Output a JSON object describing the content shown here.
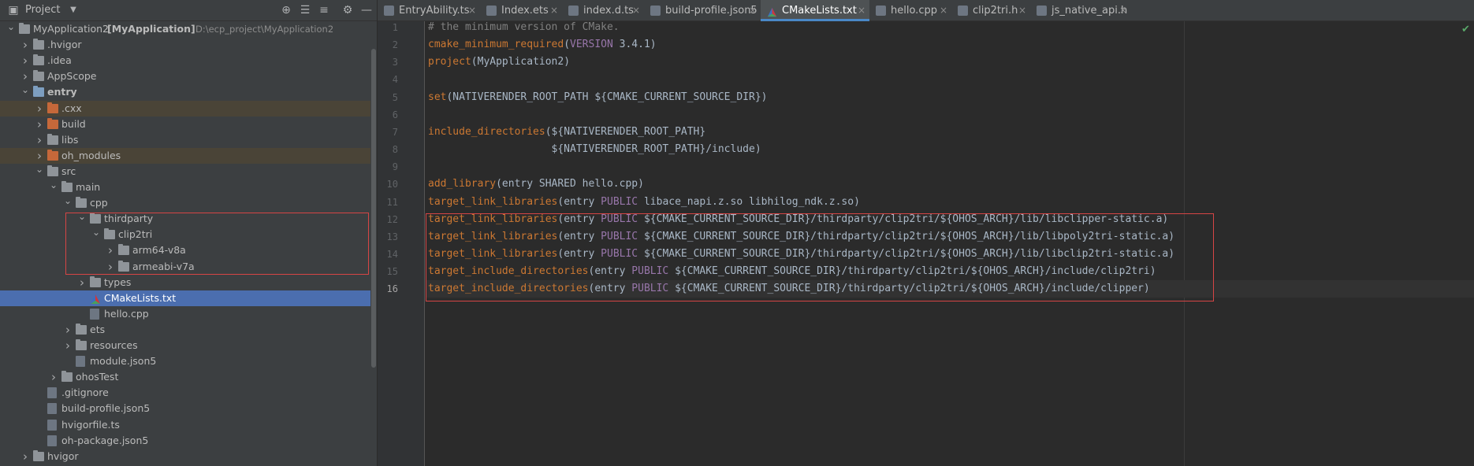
{
  "project_panel": {
    "title": "Project",
    "tree": [
      {
        "label": "MyApplication2",
        "bold_suffix": "[MyApplication]",
        "path": "D:\\ecp_project\\MyApplication2",
        "depth": 0,
        "arrow": "down",
        "icon": "folder"
      },
      {
        "label": ".hvigor",
        "depth": 1,
        "arrow": "right",
        "icon": "folder"
      },
      {
        "label": ".idea",
        "depth": 1,
        "arrow": "right",
        "icon": "folder"
      },
      {
        "label": "AppScope",
        "depth": 1,
        "arrow": "right",
        "icon": "folder"
      },
      {
        "label": "entry",
        "depth": 1,
        "arrow": "down",
        "icon": "folder-blue",
        "bold": true
      },
      {
        "label": ".cxx",
        "depth": 2,
        "arrow": "right",
        "icon": "folder-orange",
        "highlight": true
      },
      {
        "label": "build",
        "depth": 2,
        "arrow": "right",
        "icon": "folder-orange"
      },
      {
        "label": "libs",
        "depth": 2,
        "arrow": "right",
        "icon": "folder"
      },
      {
        "label": "oh_modules",
        "depth": 2,
        "arrow": "right",
        "icon": "folder-orange",
        "highlight": true
      },
      {
        "label": "src",
        "depth": 2,
        "arrow": "down",
        "icon": "folder"
      },
      {
        "label": "main",
        "depth": 3,
        "arrow": "down",
        "icon": "folder"
      },
      {
        "label": "cpp",
        "depth": 4,
        "arrow": "down",
        "icon": "folder"
      },
      {
        "label": "thirdparty",
        "depth": 5,
        "arrow": "down",
        "icon": "folder"
      },
      {
        "label": "clip2tri",
        "depth": 6,
        "arrow": "down",
        "icon": "folder"
      },
      {
        "label": "arm64-v8a",
        "depth": 7,
        "arrow": "right",
        "icon": "folder"
      },
      {
        "label": "armeabi-v7a",
        "depth": 7,
        "arrow": "right",
        "icon": "folder"
      },
      {
        "label": "types",
        "depth": 5,
        "arrow": "right",
        "icon": "folder"
      },
      {
        "label": "CMakeLists.txt",
        "depth": 5,
        "arrow": "none",
        "icon": "cmake",
        "selected": true
      },
      {
        "label": "hello.cpp",
        "depth": 5,
        "arrow": "none",
        "icon": "file"
      },
      {
        "label": "ets",
        "depth": 4,
        "arrow": "right",
        "icon": "folder"
      },
      {
        "label": "resources",
        "depth": 4,
        "arrow": "right",
        "icon": "folder"
      },
      {
        "label": "module.json5",
        "depth": 4,
        "arrow": "none",
        "icon": "file"
      },
      {
        "label": "ohosTest",
        "depth": 3,
        "arrow": "right",
        "icon": "folder"
      },
      {
        "label": ".gitignore",
        "depth": 2,
        "arrow": "none",
        "icon": "file"
      },
      {
        "label": "build-profile.json5",
        "depth": 2,
        "arrow": "none",
        "icon": "file"
      },
      {
        "label": "hvigorfile.ts",
        "depth": 2,
        "arrow": "none",
        "icon": "file"
      },
      {
        "label": "oh-package.json5",
        "depth": 2,
        "arrow": "none",
        "icon": "file"
      },
      {
        "label": "hvigor",
        "depth": 1,
        "arrow": "right",
        "icon": "folder"
      }
    ]
  },
  "tabs": [
    {
      "label": "EntryAbility.ts",
      "active": false
    },
    {
      "label": "Index.ets",
      "active": false
    },
    {
      "label": "index.d.ts",
      "active": false
    },
    {
      "label": "build-profile.json5",
      "active": false
    },
    {
      "label": "CMakeLists.txt",
      "active": true
    },
    {
      "label": "hello.cpp",
      "active": false
    },
    {
      "label": "clip2tri.h",
      "active": false
    },
    {
      "label": "js_native_api.h",
      "active": false
    }
  ],
  "editor": {
    "lines": [
      [
        {
          "t": "# the minimum version of CMake.",
          "c": "cm"
        }
      ],
      [
        {
          "t": "cmake_minimum_required",
          "c": "fn"
        },
        {
          "t": "(",
          "c": ""
        },
        {
          "t": "VERSION",
          "c": "kw"
        },
        {
          "t": " 3.4.1)",
          "c": ""
        }
      ],
      [
        {
          "t": "project",
          "c": "fn"
        },
        {
          "t": "(MyApplication2)",
          "c": ""
        }
      ],
      [],
      [
        {
          "t": "set",
          "c": "fn"
        },
        {
          "t": "(NATIVERENDER_ROOT_PATH ${CMAKE_CURRENT_SOURCE_DIR})",
          "c": ""
        }
      ],
      [],
      [
        {
          "t": "include_directories",
          "c": "fn"
        },
        {
          "t": "(${NATIVERENDER_ROOT_PATH}",
          "c": ""
        }
      ],
      [
        {
          "t": "                    ${NATIVERENDER_ROOT_PATH}/include)",
          "c": ""
        }
      ],
      [],
      [
        {
          "t": "add_library",
          "c": "fn"
        },
        {
          "t": "(entry SHARED hello.cpp)",
          "c": ""
        }
      ],
      [
        {
          "t": "target_link_libraries",
          "c": "fn"
        },
        {
          "t": "(entry ",
          "c": ""
        },
        {
          "t": "PUBLIC",
          "c": "kw"
        },
        {
          "t": " libace_napi.z.so libhilog_ndk.z.so)",
          "c": ""
        }
      ],
      [
        {
          "t": "target_link_libraries",
          "c": "fn"
        },
        {
          "t": "(entry ",
          "c": ""
        },
        {
          "t": "PUBLIC",
          "c": "kw"
        },
        {
          "t": " ${CMAKE_CURRENT_SOURCE_DIR}/thirdparty/clip2tri/${OHOS_ARCH}/lib/libclipper-static.a)",
          "c": ""
        }
      ],
      [
        {
          "t": "target_link_libraries",
          "c": "fn"
        },
        {
          "t": "(entry ",
          "c": ""
        },
        {
          "t": "PUBLIC",
          "c": "kw"
        },
        {
          "t": " ${CMAKE_CURRENT_SOURCE_DIR}/thirdparty/clip2tri/${OHOS_ARCH}/lib/libpoly2tri-static.a)",
          "c": ""
        }
      ],
      [
        {
          "t": "target_link_libraries",
          "c": "fn"
        },
        {
          "t": "(entry ",
          "c": ""
        },
        {
          "t": "PUBLIC",
          "c": "kw"
        },
        {
          "t": " ${CMAKE_CURRENT_SOURCE_DIR}/thirdparty/clip2tri/${OHOS_ARCH}/lib/libclip2tri-static.a)",
          "c": ""
        }
      ],
      [
        {
          "t": "target_include_directories",
          "c": "fn"
        },
        {
          "t": "(entry ",
          "c": ""
        },
        {
          "t": "PUBLIC",
          "c": "kw"
        },
        {
          "t": " ${CMAKE_CURRENT_SOURCE_DIR}/thirdparty/clip2tri/${OHOS_ARCH}/include/clip2tri)",
          "c": ""
        }
      ],
      [
        {
          "t": "target_include_directories",
          "c": "fn"
        },
        {
          "t": "(entry ",
          "c": ""
        },
        {
          "t": "PUBLIC",
          "c": "kw"
        },
        {
          "t": " ${CMAKE_CURRENT_SOURCE_DIR}/thirdparty/clip2tri/${OHOS_ARCH}/include/clipper)",
          "c": ""
        }
      ]
    ],
    "current_line": 16
  },
  "colors": {
    "selection": "#4b6eaf",
    "highlight_row": "#4a4437",
    "annotation_box": "#d64545",
    "accent_tab": "#4a88c7"
  }
}
